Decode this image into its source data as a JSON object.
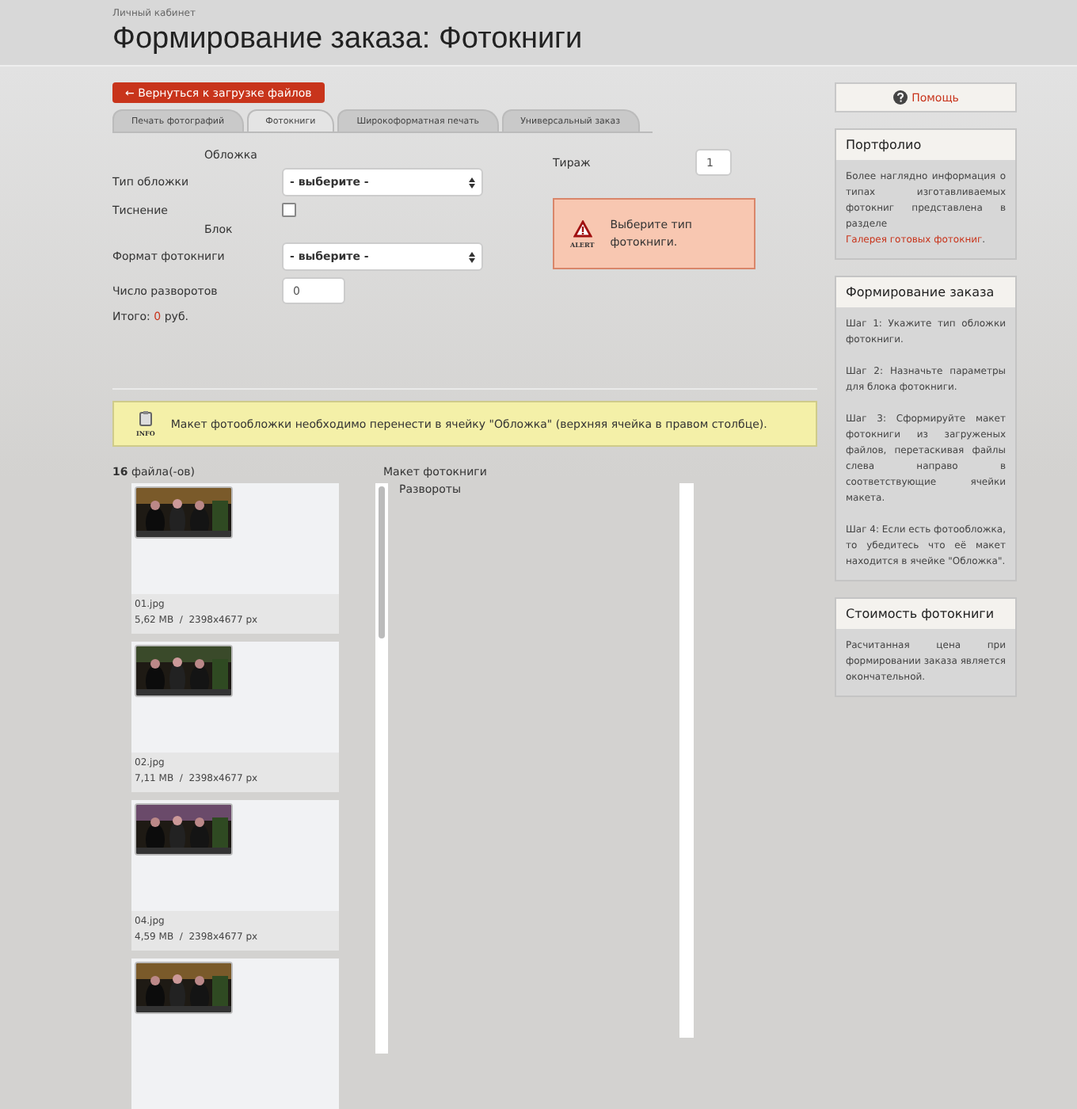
{
  "breadcrumb": "Личный кабинет",
  "title": "Формирование заказа: Фотокниги",
  "back_button": "← Вернуться к загрузке файлов",
  "tabs": [
    {
      "label": "Печать фотографий",
      "selected": false
    },
    {
      "label": "Фотокниги",
      "selected": true
    },
    {
      "label": "Широкоформатная печать",
      "selected": false
    },
    {
      "label": "Универсальный заказ",
      "selected": false
    }
  ],
  "form": {
    "cover_heading": "Обложка",
    "cover_type": {
      "label": "Тип обложки",
      "value": "- выберите -"
    },
    "embossing": {
      "label": "Тиснение",
      "checked": false
    },
    "block_heading": "Блок",
    "format": {
      "label": "Формат фотокниги",
      "value": "- выберите -"
    },
    "spreads": {
      "label": "Число разворотов",
      "value": "0"
    },
    "total": {
      "label": "Итого:",
      "amount": "0",
      "unit": "руб."
    }
  },
  "copies": {
    "label": "Тираж",
    "value": "1"
  },
  "alert": {
    "badge": "ALERT",
    "text": "Выберите тип фотокниги."
  },
  "info": {
    "badge": "INFO",
    "text": "Макет фотообложки необходимо перенести в ячейку \"Обложка\" (верхняя ячейка в правом столбце)."
  },
  "files_count": "**16** файла(-ов)",
  "files": [
    {
      "name": "01.jpg",
      "details": "5,62 MB  /  2398x4677 px",
      "cut_off": false
    },
    {
      "name": "02.jpg",
      "details": "7,11 MB  /  2398x4677 px",
      "cut_off": false
    },
    {
      "name": "04.jpg",
      "details": "4,59 MB  /  2398x4677 px",
      "cut_off": false
    },
    {
      "cut_off": true
    }
  ],
  "layout": {
    "title": "Макет фотокниги",
    "spreads_label": "Развороты"
  },
  "sidebar": {
    "help": "Помощь",
    "panels": [
      {
        "title": "Портфолио",
        "paragraphs": [
          "Более наглядно информация о типах изготавливаемых фотокниг представлена в разделе"
        ],
        "link": "Галерея готовых фотокниг",
        "link_suffix": "."
      },
      {
        "title": "Формирование заказа",
        "paragraphs": [
          "Шаг 1: Укажите тип обложки фотокниги.",
          "Шаг 2: Назначьте параметры для блока фотокниги.",
          "Шаг 3: Сформируйте макет фотокниги из загруженых файлов, перетаскивая файлы слева направо в соответствующие ячейки макета.",
          "Шаг 4: Если есть фотообложка, то убедитесь что её макет находится в ячейке \"Обложка\"."
        ]
      },
      {
        "title": "Стоимость фотокниги",
        "paragraphs": [
          "Расчитанная цена при формировании заказа является окончательной."
        ]
      }
    ]
  }
}
